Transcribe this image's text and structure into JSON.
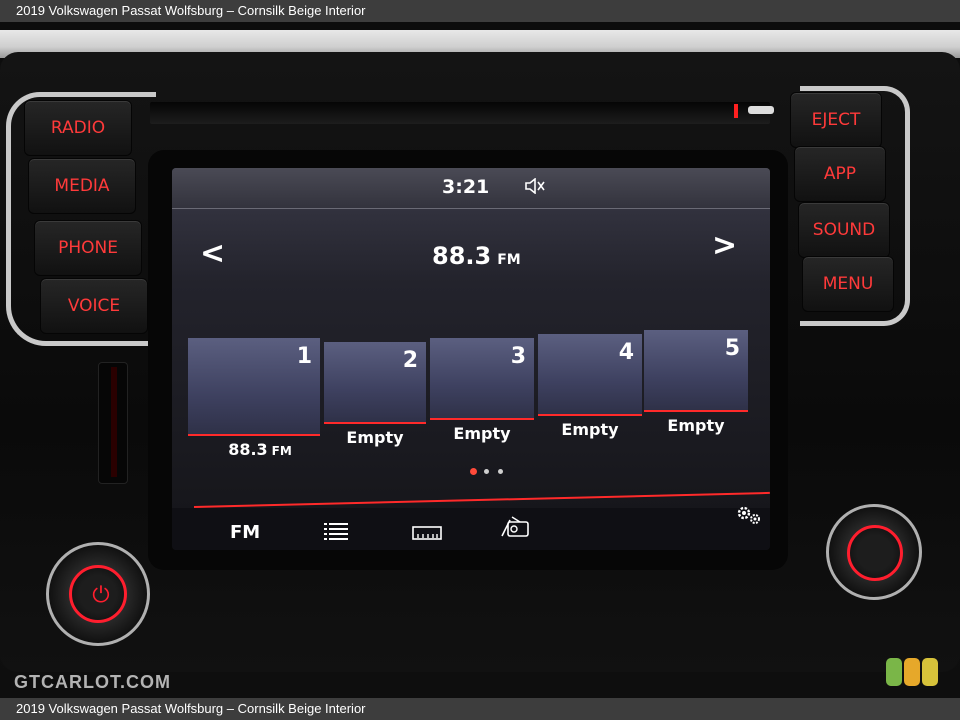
{
  "caption": {
    "top": "2019 Volkswagen Passat Wolfsburg – Cornsilk Beige Interior",
    "bottom": "2019 Volkswagen Passat Wolfsburg – Cornsilk Beige Interior"
  },
  "hardware_buttons": {
    "left": [
      "RADIO",
      "MEDIA",
      "PHONE",
      "VOICE"
    ],
    "right": [
      "EJECT",
      "APP",
      "SOUND",
      "MENU"
    ]
  },
  "screen": {
    "time": "3:21",
    "mute_icon": "speaker-muted-icon",
    "prev_arrow": "<",
    "next_arrow": ">",
    "station_freq": "88.3",
    "station_band": "FM",
    "presets": [
      {
        "number": "1",
        "label": "88.3",
        "band": "FM"
      },
      {
        "number": "2",
        "label": "Empty",
        "band": ""
      },
      {
        "number": "3",
        "label": "Empty",
        "band": ""
      },
      {
        "number": "4",
        "label": "Empty",
        "band": ""
      },
      {
        "number": "5",
        "label": "Empty",
        "band": ""
      }
    ],
    "page_count": 3,
    "active_page": 1,
    "bottom_bar": {
      "fm_label": "FM",
      "icons": [
        "station-list-icon",
        "tuner-scale-icon",
        "radio-text-icon",
        "settings-gear-icon"
      ]
    }
  },
  "watermark": "GTCARLOT.COM",
  "colors": {
    "hardware_label": "#ff3a3a",
    "accent_red": "#ff2a2a",
    "preset_tile": "#4a4e6e"
  }
}
